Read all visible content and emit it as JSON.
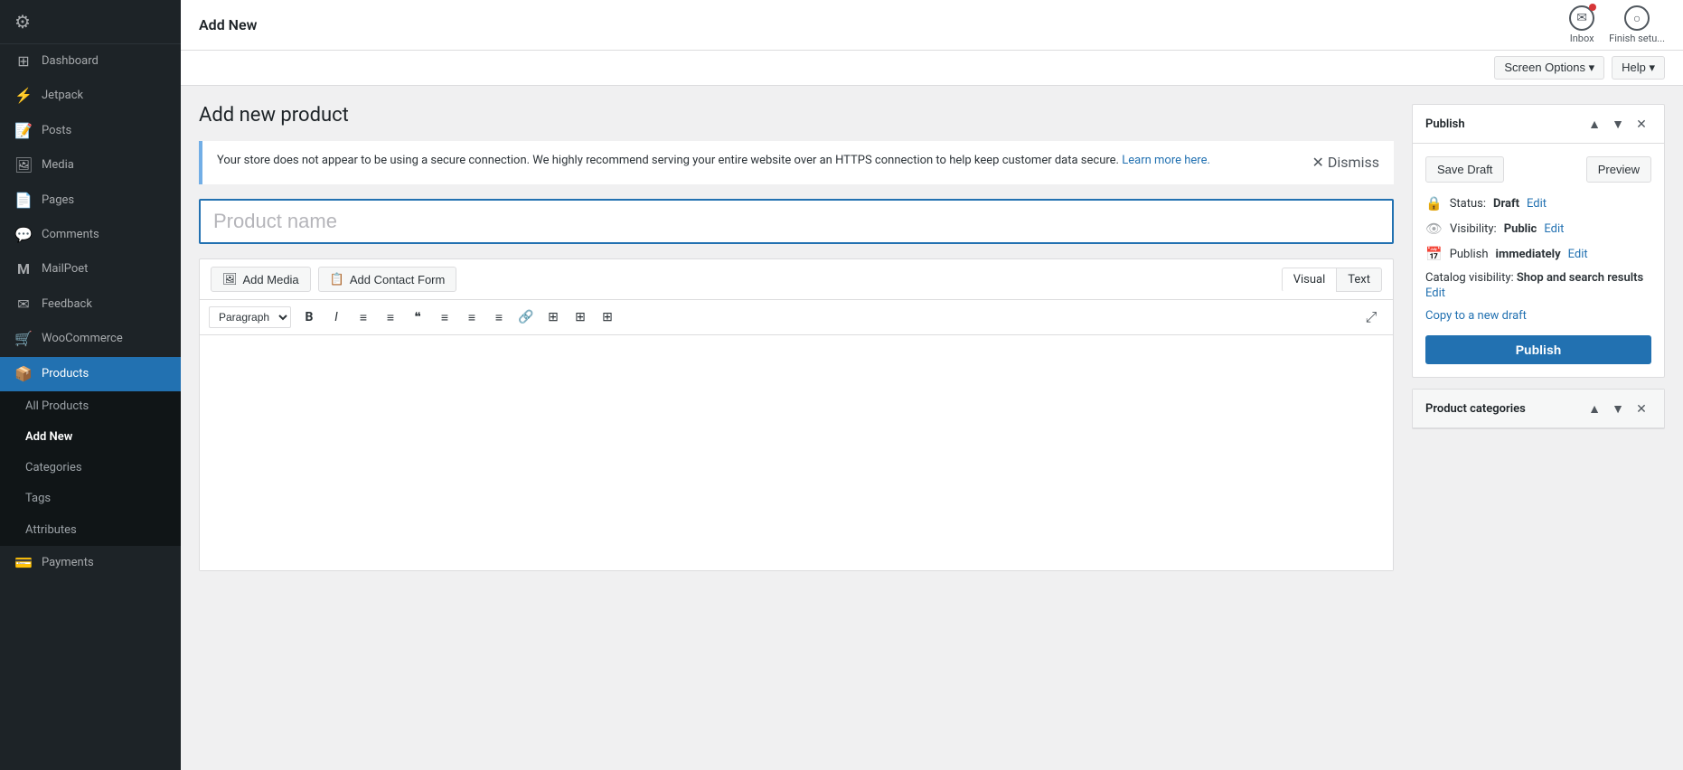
{
  "sidebar": {
    "items": [
      {
        "id": "dashboard",
        "label": "Dashboard",
        "icon": "⊞"
      },
      {
        "id": "jetpack",
        "label": "Jetpack",
        "icon": "⚡"
      },
      {
        "id": "posts",
        "label": "Posts",
        "icon": "📝"
      },
      {
        "id": "media",
        "label": "Media",
        "icon": "🖼"
      },
      {
        "id": "pages",
        "label": "Pages",
        "icon": "📄"
      },
      {
        "id": "comments",
        "label": "Comments",
        "icon": "💬"
      },
      {
        "id": "mailpoet",
        "label": "MailPoet",
        "icon": "M"
      },
      {
        "id": "feedback",
        "label": "Feedback",
        "icon": "✉"
      },
      {
        "id": "woocommerce",
        "label": "WooCommerce",
        "icon": "🛒"
      },
      {
        "id": "products",
        "label": "Products",
        "icon": "📦"
      },
      {
        "id": "payments",
        "label": "Payments",
        "icon": "💳"
      }
    ],
    "submenu": [
      {
        "id": "all-products",
        "label": "All Products"
      },
      {
        "id": "add-new",
        "label": "Add New"
      },
      {
        "id": "categories",
        "label": "Categories"
      },
      {
        "id": "tags",
        "label": "Tags"
      },
      {
        "id": "attributes",
        "label": "Attributes"
      }
    ]
  },
  "topbar": {
    "title": "Add New",
    "inbox_label": "Inbox",
    "finish_setup_label": "Finish setu..."
  },
  "screen_options": {
    "screen_options_label": "Screen Options ▾",
    "help_label": "Help ▾"
  },
  "page": {
    "title": "Add new product",
    "alert_text": "Your store does not appear to be using a secure connection. We highly recommend serving your entire website over an HTTPS connection to help keep customer data secure.",
    "alert_link_text": "Learn more here.",
    "alert_dismiss": "Dismiss",
    "product_name_placeholder": "Product name",
    "add_media_label": "Add Media",
    "add_contact_form_label": "Add Contact Form",
    "visual_tab": "Visual",
    "text_tab": "Text",
    "paragraph_label": "Paragraph",
    "toolbar_buttons": [
      "B",
      "I",
      "≡",
      "≡",
      "❝",
      "≡",
      "≡",
      "≡",
      "🔗",
      "⊞",
      "⊞",
      "⊞"
    ]
  },
  "publish_panel": {
    "title": "Publish",
    "save_draft_label": "Save Draft",
    "preview_label": "Preview",
    "status_label": "Status:",
    "status_value": "Draft",
    "status_edit": "Edit",
    "visibility_label": "Visibility:",
    "visibility_value": "Public",
    "visibility_edit": "Edit",
    "publish_label": "Publish",
    "publish_time": "immediately",
    "publish_edit": "Edit",
    "catalog_visibility_label": "Catalog visibility:",
    "catalog_visibility_value": "Shop and search results",
    "catalog_visibility_edit": "Edit",
    "copy_draft_label": "Copy to a new draft",
    "publish_button": "Publish"
  },
  "product_categories_panel": {
    "title": "Product categories"
  }
}
